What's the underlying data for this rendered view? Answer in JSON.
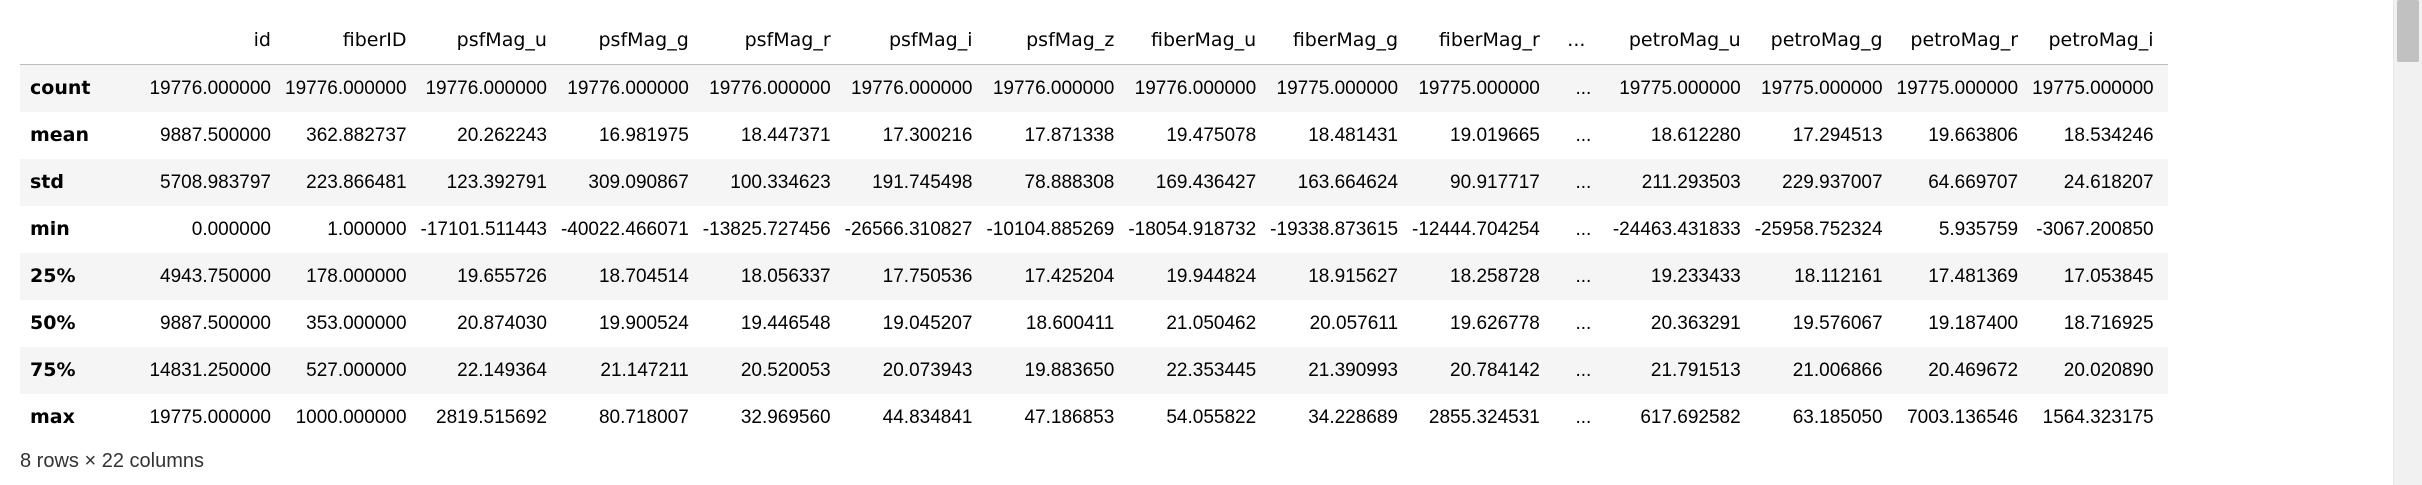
{
  "columns": [
    "id",
    "fiberID",
    "psfMag_u",
    "psfMag_g",
    "psfMag_r",
    "psfMag_i",
    "psfMag_z",
    "fiberMag_u",
    "fiberMag_g",
    "fiberMag_r",
    "...",
    "petroMag_u",
    "petroMag_g",
    "petroMag_r",
    "petroMag_i"
  ],
  "rows": [
    {
      "label": "count",
      "cells": [
        "19776.000000",
        "19776.000000",
        "19776.000000",
        "19776.000000",
        "19776.000000",
        "19776.000000",
        "19776.000000",
        "19776.000000",
        "19775.000000",
        "19775.000000",
        "...",
        "19775.000000",
        "19775.000000",
        "19775.000000",
        "19775.000000"
      ]
    },
    {
      "label": "mean",
      "cells": [
        "9887.500000",
        "362.882737",
        "20.262243",
        "16.981975",
        "18.447371",
        "17.300216",
        "17.871338",
        "19.475078",
        "18.481431",
        "19.019665",
        "...",
        "18.612280",
        "17.294513",
        "19.663806",
        "18.534246"
      ]
    },
    {
      "label": "std",
      "cells": [
        "5708.983797",
        "223.866481",
        "123.392791",
        "309.090867",
        "100.334623",
        "191.745498",
        "78.888308",
        "169.436427",
        "163.664624",
        "90.917717",
        "...",
        "211.293503",
        "229.937007",
        "64.669707",
        "24.618207"
      ]
    },
    {
      "label": "min",
      "cells": [
        "0.000000",
        "1.000000",
        "-17101.511443",
        "-40022.466071",
        "-13825.727456",
        "-26566.310827",
        "-10104.885269",
        "-18054.918732",
        "-19338.873615",
        "-12444.704254",
        "...",
        "-24463.431833",
        "-25958.752324",
        "5.935759",
        "-3067.200850"
      ]
    },
    {
      "label": "25%",
      "cells": [
        "4943.750000",
        "178.000000",
        "19.655726",
        "18.704514",
        "18.056337",
        "17.750536",
        "17.425204",
        "19.944824",
        "18.915627",
        "18.258728",
        "...",
        "19.233433",
        "18.112161",
        "17.481369",
        "17.053845"
      ]
    },
    {
      "label": "50%",
      "cells": [
        "9887.500000",
        "353.000000",
        "20.874030",
        "19.900524",
        "19.446548",
        "19.045207",
        "18.600411",
        "21.050462",
        "20.057611",
        "19.626778",
        "...",
        "20.363291",
        "19.576067",
        "19.187400",
        "18.716925"
      ]
    },
    {
      "label": "75%",
      "cells": [
        "14831.250000",
        "527.000000",
        "22.149364",
        "21.147211",
        "20.520053",
        "20.073943",
        "19.883650",
        "22.353445",
        "21.390993",
        "20.784142",
        "...",
        "21.791513",
        "21.006866",
        "20.469672",
        "20.020890"
      ]
    },
    {
      "label": "max",
      "cells": [
        "19775.000000",
        "1000.000000",
        "2819.515692",
        "80.718007",
        "32.969560",
        "44.834841",
        "47.186853",
        "54.055822",
        "34.228689",
        "2855.324531",
        "...",
        "617.692582",
        "63.185050",
        "7003.136546",
        "1564.323175"
      ]
    }
  ],
  "cutoff_mark": "-",
  "footer": "8 rows × 22 columns"
}
